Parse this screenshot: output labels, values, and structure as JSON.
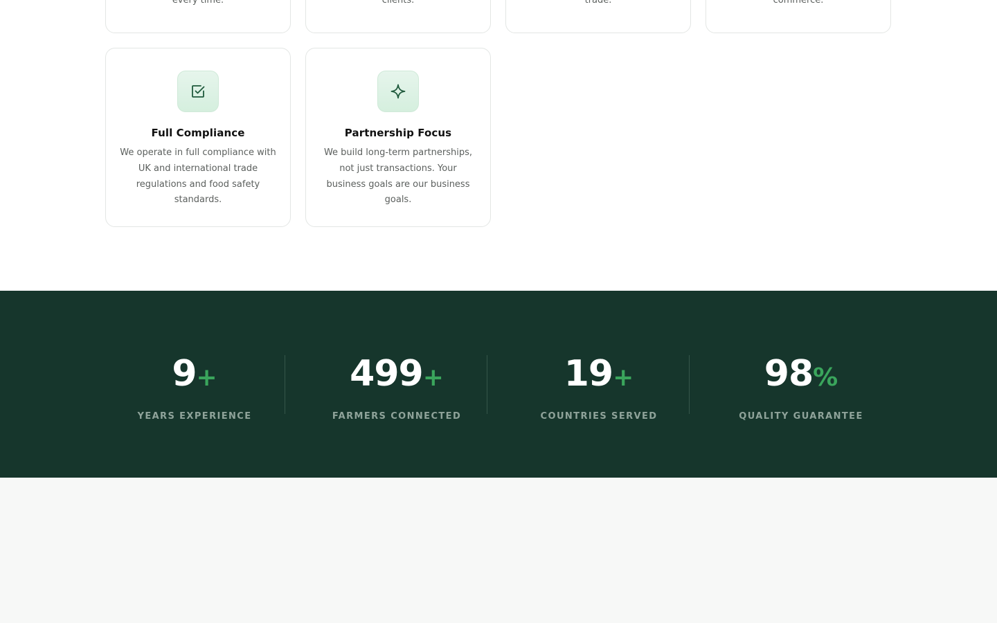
{
  "values_cards": {
    "top_row": [
      {
        "desc_tail": "every time."
      },
      {
        "desc_tail": "clients."
      },
      {
        "desc_tail": "trade."
      },
      {
        "desc_tail": "commerce."
      }
    ],
    "cards": [
      {
        "icon": "checkbox-check-icon",
        "title": "Full Compliance",
        "description": "We operate in full compliance with UK and international trade regulations and food safety standards."
      },
      {
        "icon": "sparkle-star-icon",
        "title": "Partnership Focus",
        "description": "We build long-term partnerships, not just transactions. Your business goals are our business goals."
      }
    ]
  },
  "stats": [
    {
      "value": "9",
      "suffix": "+",
      "label": "YEARS EXPERIENCE"
    },
    {
      "value": "499",
      "suffix": "+",
      "label": "FARMERS CONNECTED"
    },
    {
      "value": "19",
      "suffix": "+",
      "label": "COUNTRIES SERVED"
    },
    {
      "value": "98",
      "suffix": "%",
      "label": "QUALITY GUARANTEE"
    }
  ],
  "colors": {
    "stats_background": "#16362c",
    "accent_green": "#3aa55c",
    "icon_green": "#1f5a3c"
  }
}
